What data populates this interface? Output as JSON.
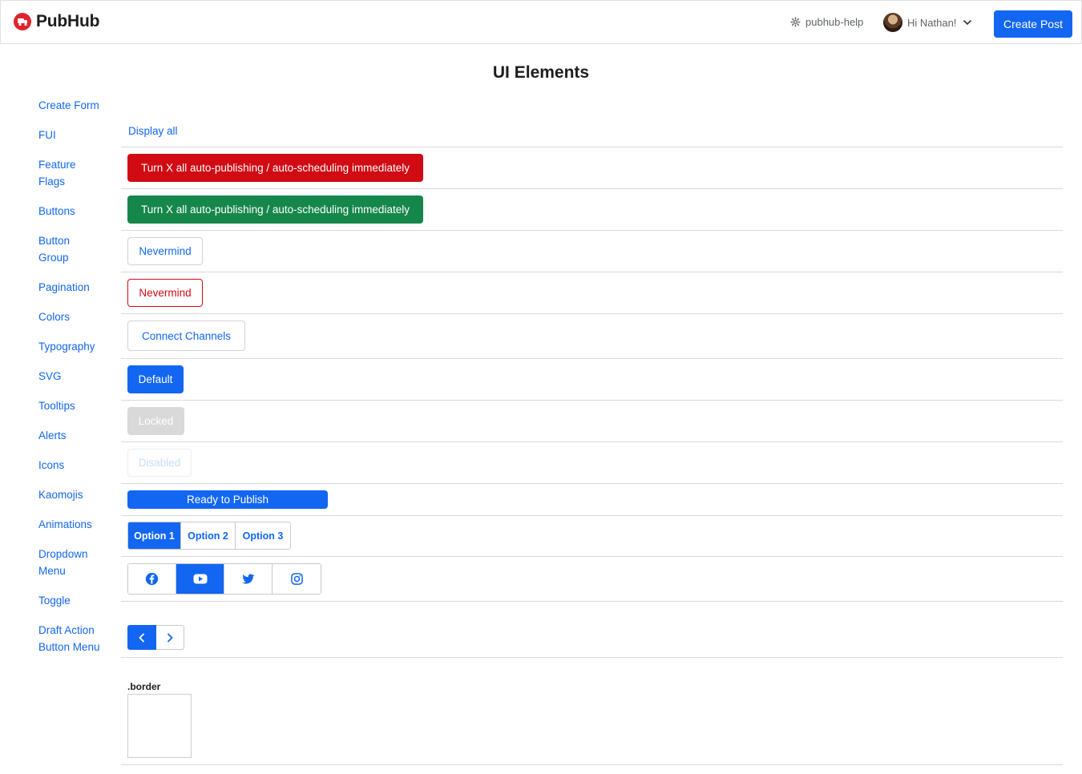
{
  "header": {
    "brand_name": "PubHub",
    "help_label": "pubhub-help",
    "user_greeting": "Hi Nathan!",
    "create_post_label": "Create Post"
  },
  "page": {
    "title": "UI Elements"
  },
  "sidebar": {
    "items": [
      {
        "label": "Create Form"
      },
      {
        "label": "FUI"
      },
      {
        "label": "Feature Flags"
      },
      {
        "label": "Buttons"
      },
      {
        "label": "Button Group"
      },
      {
        "label": "Pagination"
      },
      {
        "label": "Colors"
      },
      {
        "label": "Typography"
      },
      {
        "label": "SVG"
      },
      {
        "label": "Tooltips"
      },
      {
        "label": "Alerts"
      },
      {
        "label": "Icons"
      },
      {
        "label": "Kaomojis"
      },
      {
        "label": "Animations"
      },
      {
        "label": "Dropdown Menu"
      },
      {
        "label": "Toggle"
      },
      {
        "label": "Draft Action Button Menu"
      }
    ]
  },
  "main": {
    "display_all": "Display all",
    "buttons": {
      "red": "Turn X all auto-publishing / auto-scheduling immediately",
      "green": "Turn X all auto-publishing / auto-scheduling immediately",
      "nevermind_outline": "Nevermind",
      "nevermind_red": "Nevermind",
      "connect_channels": "Connect Channels",
      "default": "Default",
      "locked": "Locked",
      "disabled": "Disabled",
      "ready_to_publish": "Ready to Publish"
    },
    "button_group": {
      "options": [
        {
          "label": "Option 1",
          "active": true
        },
        {
          "label": "Option 2",
          "active": false
        },
        {
          "label": "Option 3",
          "active": false
        }
      ]
    },
    "social_group": {
      "items": [
        {
          "icon": "facebook-icon",
          "active": false
        },
        {
          "icon": "youtube-icon",
          "active": true
        },
        {
          "icon": "twitter-icon",
          "active": false
        },
        {
          "icon": "instagram-icon",
          "active": false
        }
      ]
    },
    "border_demo": {
      "label": ".border"
    }
  },
  "colors": {
    "primary": "#1266f1",
    "danger": "#d10b14",
    "success": "#16874a",
    "brand": "#e0242e",
    "locked": "#d9d9d9"
  }
}
